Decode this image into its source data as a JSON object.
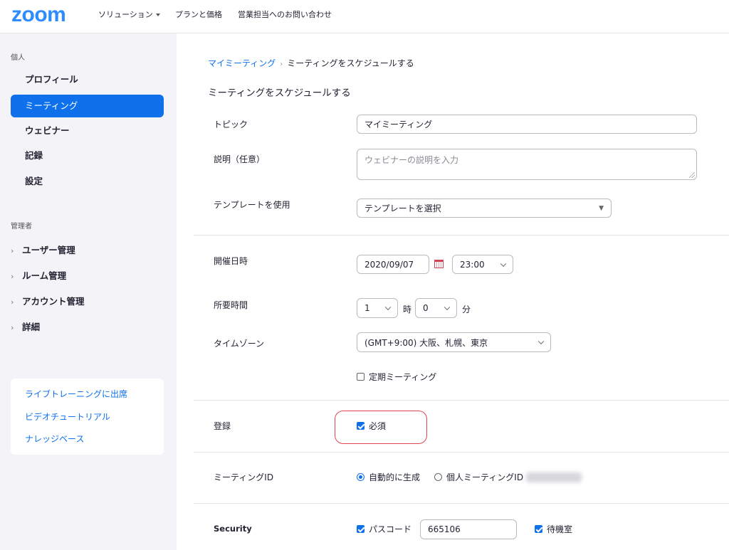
{
  "header": {
    "logo": "zoom",
    "nav": [
      "ソリューション",
      "プランと価格",
      "営業担当へのお問い合わせ"
    ]
  },
  "sidebar": {
    "personal_heading": "個人",
    "personal_items": [
      "プロフィール",
      "ミーティング",
      "ウェビナー",
      "記録",
      "設定"
    ],
    "active_item": "ミーティング",
    "admin_heading": "管理者",
    "admin_items": [
      "ユーザー管理",
      "ルーム管理",
      "アカウント管理",
      "詳細"
    ],
    "help_links": [
      "ライブトレーニングに出席",
      "ビデオチュートリアル",
      "ナレッジベース"
    ]
  },
  "breadcrumb": {
    "parent": "マイミーティング",
    "sep": "›",
    "current": "ミーティングをスケジュールする"
  },
  "page_title": "ミーティングをスケジュールする",
  "form": {
    "topic_label": "トピック",
    "topic_value": "マイミーティング",
    "desc_label": "説明（任意）",
    "desc_placeholder": "ウェビナーの説明を入力",
    "template_label": "テンプレートを使用",
    "template_value": "テンプレートを選択",
    "when_label": "開催日時",
    "date_value": "2020/09/07",
    "time_value": "23:00",
    "duration_label": "所要時間",
    "hours_value": "1",
    "hours_unit": "時",
    "minutes_value": "0",
    "minutes_unit": "分",
    "timezone_label": "タイムゾーン",
    "timezone_value": "(GMT+9:00) 大阪、札幌、東京",
    "recurring_label": "定期ミーティング",
    "recurring_checked": false,
    "registration_label": "登録",
    "required_label": "必須",
    "required_checked": true,
    "meeting_id_label": "ミーティングID",
    "auto_generate_label": "自動的に生成",
    "personal_id_label": "個人ミーティングID",
    "security_label": "Security",
    "passcode_label": "パスコード",
    "passcode_checked": true,
    "passcode_value": "665106",
    "waiting_room_label": "待機室",
    "waiting_room_checked": true
  },
  "colors": {
    "brand": "#2d8cff",
    "active_bg": "#0e71eb",
    "highlight_border": "#e0454f"
  }
}
